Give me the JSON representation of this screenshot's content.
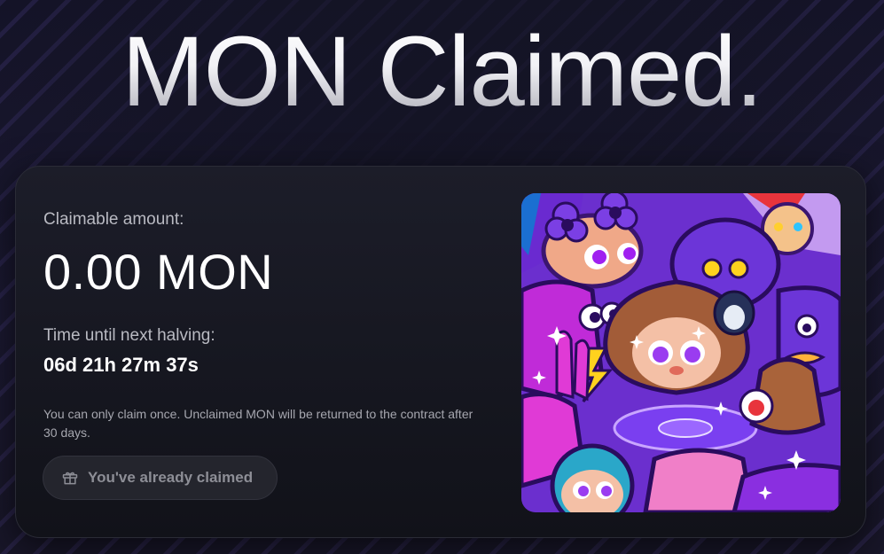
{
  "headline": "MON Claimed.",
  "claim_card": {
    "amount_label": "Claimable amount:",
    "amount_value": "0.00 MON",
    "halving_label": "Time until next halving:",
    "halving_countdown": "06d 21h 27m 37s",
    "notice": "You can only claim once. Unclaimed MON will be returned to the contract after 30 days.",
    "button_label": "You've already claimed",
    "button_icon": "gift-icon",
    "artwork": "purple-monkey-mascot-collage"
  },
  "colors": {
    "background": "#161628",
    "card": "#16171f",
    "accent_purple": "#7b3fe4",
    "button_bg": "#24252d"
  }
}
